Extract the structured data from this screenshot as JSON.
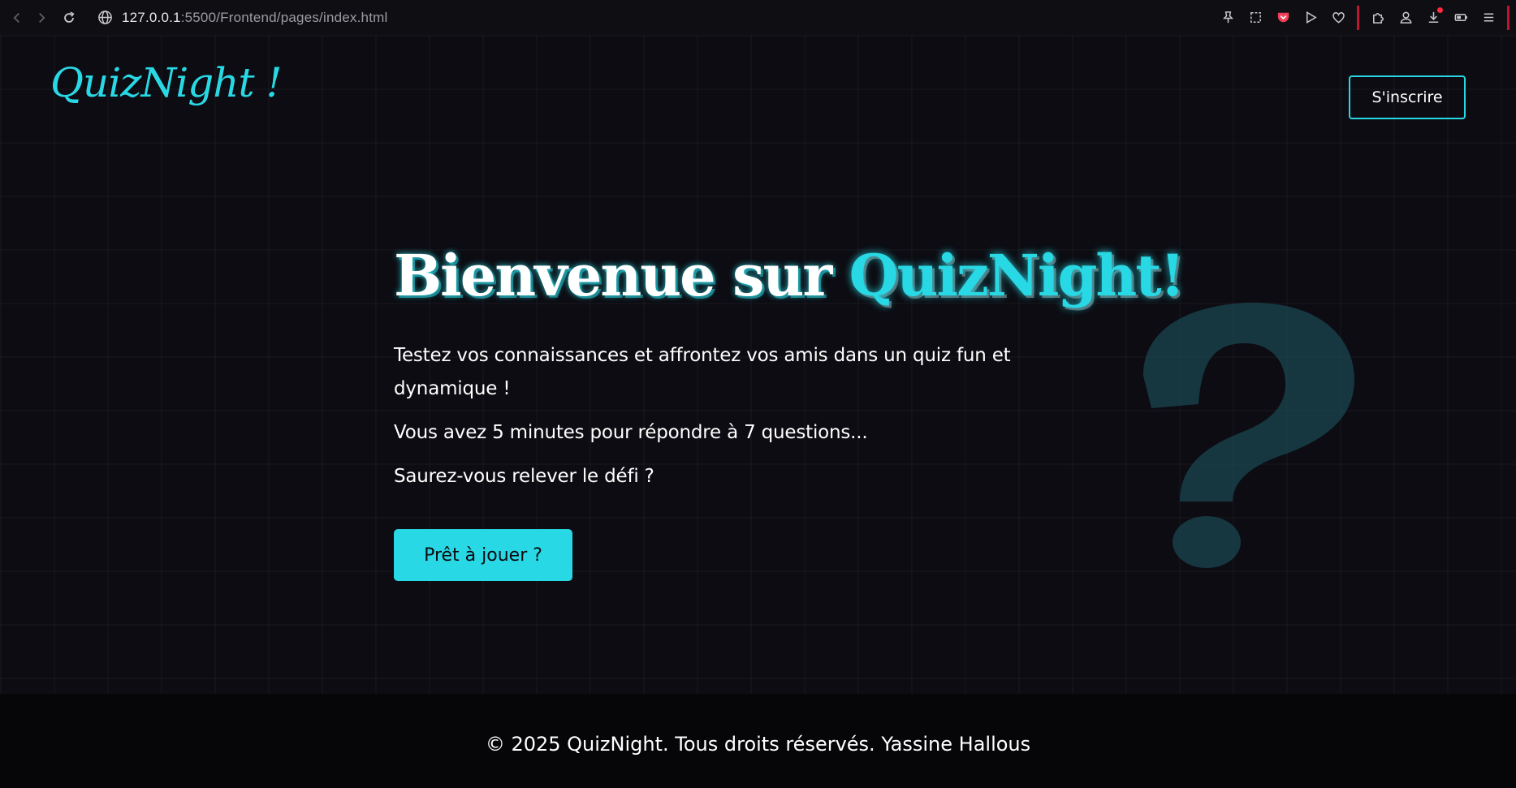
{
  "browser": {
    "url_host": "127.0.0.1",
    "url_path": ":5500/Frontend/pages/index.html"
  },
  "header": {
    "logo": "QuizNight !",
    "signup_label": "S'inscrire"
  },
  "hero": {
    "title_prefix": "Bienvenue sur",
    "title_accent": "QuizNight!",
    "paragraph_1": "Testez vos connaissances et affrontez vos amis dans un quiz fun et dynamique !",
    "paragraph_2": "Vous avez 5 minutes pour répondre à 7 questions...",
    "paragraph_3": "Saurez-vous relever le défi ?",
    "cta_label": "Prêt à jouer ?"
  },
  "footer": {
    "text": "© 2025 QuizNight. Tous droits réservés. Yassine Hallous"
  },
  "icons": {
    "back": "chevron-left-icon",
    "forward": "chevron-right-icon",
    "reload": "reload-icon",
    "site": "globe-icon",
    "decoration": "question-mark-icon"
  },
  "colors": {
    "accent": "#28d9e5",
    "background": "#0c0c12",
    "footer_background": "#060608",
    "text": "#ffffff"
  }
}
